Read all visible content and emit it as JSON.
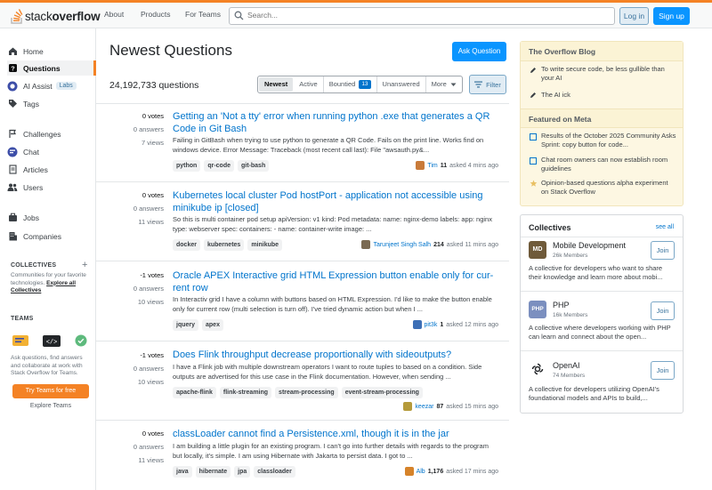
{
  "header": {
    "logo_prefix": "stack",
    "logo_suffix": "overflow",
    "nav": [
      "About",
      "Products",
      "For Teams"
    ],
    "search_placeholder": "Search...",
    "login": "Log in",
    "signup": "Sign up"
  },
  "sidebar": {
    "items": [
      {
        "label": "Home",
        "icon": "home-icon"
      },
      {
        "label": "Questions",
        "icon": "questions-icon",
        "active": true
      },
      {
        "label": "AI Assist",
        "icon": "ai-assist-icon",
        "badge": "Labs"
      },
      {
        "label": "Tags",
        "icon": "tag-icon"
      },
      {
        "label": "Challenges",
        "icon": "challenges-icon"
      },
      {
        "label": "Chat",
        "icon": "chat-icon"
      },
      {
        "label": "Articles",
        "icon": "articles-icon"
      },
      {
        "label": "Users",
        "icon": "users-icon"
      },
      {
        "label": "Jobs",
        "icon": "jobs-icon"
      },
      {
        "label": "Companies",
        "icon": "companies-icon"
      }
    ],
    "collectives_heading": "COLLECTIVES",
    "collectives_text": "Communities for your favorite technologies.",
    "collectives_link": "Explore all Collectives",
    "teams_heading": "TEAMS",
    "teams_text": "Ask questions, find answers and collaborate at work with Stack Overflow for Teams.",
    "teams_button": "Try Teams for free",
    "teams_explore": "Explore Teams"
  },
  "main": {
    "title": "Newest Questions",
    "ask_button": "Ask Question",
    "count": "24,192,733 questions",
    "tabs": [
      {
        "label": "Newest",
        "active": true
      },
      {
        "label": "Active"
      },
      {
        "label": "Bountied",
        "count": "13"
      },
      {
        "label": "Unanswered"
      },
      {
        "label": "More"
      }
    ],
    "filter": "Filter",
    "questions": [
      {
        "votes": "0 votes",
        "answers": "0 answers",
        "views": "7 views",
        "title": "Getting an 'Not a tty' error when running python .exe that generates a QR Code in Git Bash",
        "excerpt": "Failing in GitBash when trying to use python to generate a QR Code. Fails on the print line. Works find on windows device. Error Message: Traceback (most recent call last): File \"awsauth.py&...",
        "tags": [
          "python",
          "qr-code",
          "git-bash"
        ],
        "user": "Tim",
        "rep": "11",
        "time": "asked 4 mins ago",
        "avatar_color": "#c97b3a"
      },
      {
        "votes": "0 votes",
        "answers": "0 answers",
        "views": "11 views",
        "title": "Kubernetes local cluster Pod hostPort - application not accessible using minikube ip [closed]",
        "excerpt": "So this is multi container pod setup apiVersion: v1 kind: Pod metadata: name: nginx-demo labels: app: nginx type: webserver spec: containers: - name: container-write image: ...",
        "tags": [
          "docker",
          "kubernetes",
          "minikube"
        ],
        "user": "Tarunjeet Singh Salh",
        "rep": "214",
        "time": "asked 11 mins ago",
        "avatar_color": "#7a6a52"
      },
      {
        "votes": "-1 votes",
        "answers": "0 answers",
        "views": "10 views",
        "title": "Oracle APEX Interactive grid HTML Expression button enable only for cur­rent row",
        "excerpt": "In Interactiv grid I have a column with buttons based on HTML Expression. I'd like to make the button enable only for current row (multi selection is turn off). I've tried dynamic action but when I ...",
        "tags": [
          "jquery",
          "apex"
        ],
        "user": "pit3k",
        "rep": "1",
        "time": "asked 12 mins ago",
        "avatar_color": "#3d6fb6"
      },
      {
        "votes": "-1 votes",
        "answers": "0 answers",
        "views": "10 views",
        "title": "Does Flink throughput decrease proportionally with sideoutputs?",
        "excerpt": "I have a Flink job with multiple downstream operators I want to route tuples to based on a condition. Side outputs are advertised for this use case in the Flink documentation. However, when sending ...",
        "tags": [
          "apache-flink",
          "flink-streaming",
          "stream-processing",
          "event-stream-processing"
        ],
        "user": "keezar",
        "rep": "87",
        "time": "asked 15 mins ago",
        "avatar_color": "#b59a3a"
      },
      {
        "votes": "0 votes",
        "answers": "0 answers",
        "views": "11 views",
        "title": "classLoader cannot find a Persistence.xml, though it is in the jar",
        "excerpt": "I am building a little plugin for an existing program. I can't go into further details with regards to the program but locally, it's simple. I am using Hibernate with Jakarta to persist data. I got to ...",
        "tags": [
          "java",
          "hibernate",
          "jpa",
          "classloader"
        ],
        "user": "Alb",
        "rep": "1,176",
        "time": "asked 17 mins ago",
        "avatar_color": "#d6832a"
      }
    ]
  },
  "blog": {
    "heading": "The Overflow Blog",
    "items": [
      "To write secure code, be less gullible than your AI",
      "The AI ick"
    ],
    "meta_heading": "Featured on Meta",
    "meta_items": [
      "Results of the October 2025 Community Asks Sprint: copy button for code...",
      "Chat room owners can now establish room guidelines",
      "Opinion-based questions alpha experiment on Stack Overflow"
    ]
  },
  "collectives": {
    "heading": "Collectives",
    "see_all": "see all",
    "join": "Join",
    "items": [
      {
        "logo": "MD",
        "logo_color": "#6f5a3a",
        "name": "Mobile Development",
        "members": "26k Members",
        "desc": "A collective for developers who want to share their knowledge and learn more about mobi..."
      },
      {
        "logo": "PHP",
        "logo_color": "#7b8fbf",
        "name": "PHP",
        "members": "16k Members",
        "desc": "A collective where developers working with PHP can learn and connect about the open..."
      },
      {
        "logo": "",
        "logo_color": "#ffffff",
        "name": "OpenAI",
        "members": "74 Members",
        "desc": "A collective for developers utilizing OpenAI's foundational models and APIs to build,..."
      }
    ]
  }
}
